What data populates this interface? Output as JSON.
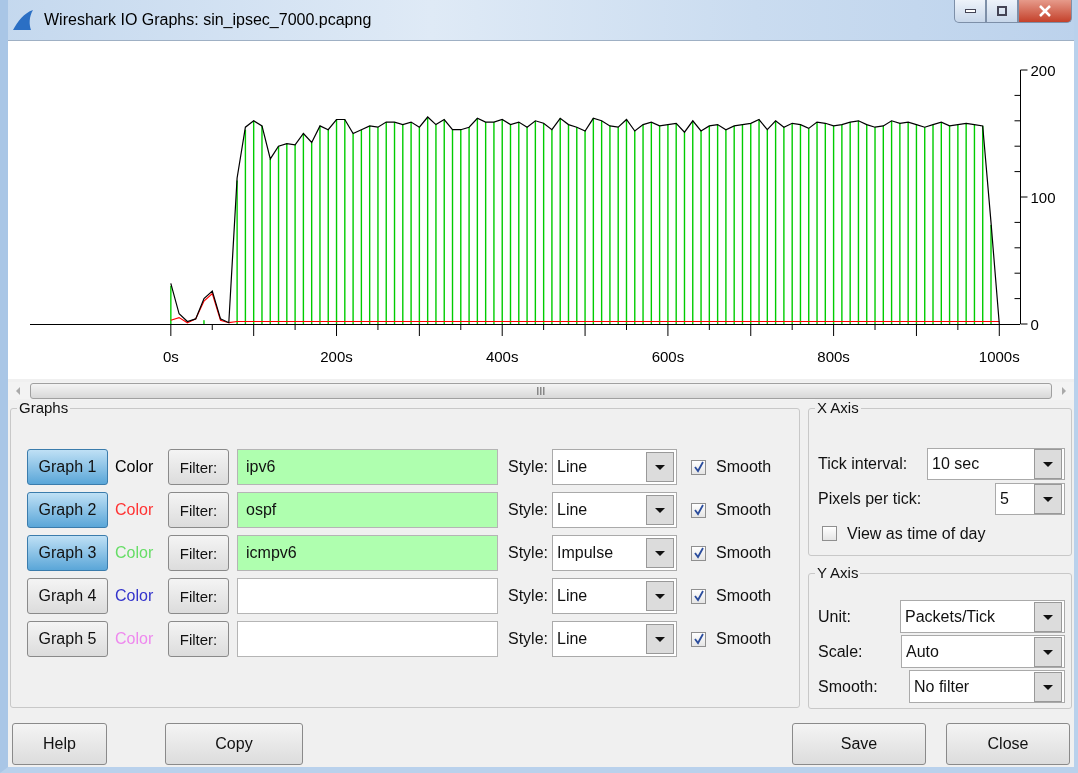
{
  "window": {
    "title": "Wireshark IO Graphs: sin_ipsec_7000.pcapng"
  },
  "chart": {
    "chart_data": {
      "type": "line",
      "xlim": [
        -170,
        1025
      ],
      "ylim": [
        0,
        200
      ],
      "xticks": [
        {
          "value": 0,
          "label": "0s"
        },
        {
          "value": 200,
          "label": "200s"
        },
        {
          "value": 400,
          "label": "400s"
        },
        {
          "value": 600,
          "label": "600s"
        },
        {
          "value": 800,
          "label": "800s"
        },
        {
          "value": 1000,
          "label": "1000s"
        }
      ],
      "yticks": [
        0,
        100,
        200
      ],
      "x": [
        0,
        10,
        20,
        30,
        40,
        50,
        60,
        70,
        80,
        90,
        100,
        110,
        120,
        130,
        140,
        150,
        160,
        170,
        180,
        190,
        200,
        210,
        220,
        230,
        240,
        250,
        260,
        270,
        280,
        290,
        300,
        310,
        320,
        330,
        340,
        350,
        360,
        370,
        380,
        390,
        400,
        410,
        420,
        430,
        440,
        450,
        460,
        470,
        480,
        490,
        500,
        510,
        520,
        530,
        540,
        550,
        560,
        570,
        580,
        590,
        600,
        610,
        620,
        630,
        640,
        650,
        660,
        670,
        680,
        690,
        700,
        710,
        720,
        730,
        740,
        750,
        760,
        770,
        780,
        790,
        800,
        810,
        820,
        830,
        840,
        850,
        860,
        870,
        880,
        890,
        900,
        910,
        920,
        930,
        940,
        950,
        960,
        970,
        980,
        990,
        1000
      ],
      "series": [
        {
          "color": "#000000",
          "values": [
            32,
            8,
            2,
            4,
            20,
            26,
            4,
            1,
            115,
            155,
            160,
            156,
            130,
            140,
            142,
            141,
            150,
            143,
            156,
            153,
            161,
            161,
            150,
            153,
            156,
            155,
            159,
            159,
            157,
            159,
            155,
            163,
            157,
            161,
            153,
            153,
            155,
            162,
            159,
            159,
            161,
            157,
            159,
            155,
            160,
            158,
            153,
            162,
            157,
            155,
            152,
            162,
            160,
            156,
            155,
            161,
            152,
            157,
            159,
            156,
            157,
            158,
            151,
            160,
            152,
            156,
            157,
            153,
            156,
            157,
            158,
            161,
            153,
            160,
            155,
            158,
            157,
            154,
            159,
            158,
            156,
            157,
            159,
            160,
            157,
            155,
            156,
            160,
            158,
            159,
            157,
            155,
            157,
            159,
            156,
            157,
            158,
            157,
            156,
            80,
            0
          ]
        },
        {
          "color": "#ff0000",
          "values": [
            3,
            5,
            1,
            4,
            18,
            24,
            3,
            1,
            2,
            2,
            2,
            2,
            2,
            2,
            2,
            2,
            2,
            2,
            2,
            2,
            2,
            2,
            2,
            2,
            2,
            2,
            2,
            2,
            2,
            2,
            2,
            2,
            2,
            2,
            2,
            2,
            2,
            2,
            2,
            2,
            2,
            2,
            2,
            2,
            2,
            2,
            2,
            2,
            2,
            2,
            2,
            2,
            2,
            2,
            2,
            2,
            2,
            2,
            2,
            2,
            2,
            2,
            2,
            2,
            2,
            2,
            2,
            2,
            2,
            2,
            2,
            2,
            2,
            2,
            2,
            2,
            2,
            2,
            2,
            2,
            2,
            2,
            2,
            2,
            2,
            2,
            2,
            2,
            2,
            2,
            2,
            2,
            2,
            2,
            2,
            2,
            2,
            2,
            2,
            2,
            2
          ]
        },
        {
          "type": "bar",
          "color": "#00cc00",
          "values": [
            30,
            null,
            null,
            null,
            3,
            null,
            null,
            null,
            113,
            153,
            160,
            156,
            130,
            140,
            142,
            141,
            150,
            143,
            156,
            153,
            161,
            161,
            150,
            153,
            156,
            155,
            159,
            159,
            157,
            159,
            155,
            163,
            157,
            161,
            153,
            153,
            155,
            162,
            159,
            159,
            161,
            157,
            159,
            155,
            160,
            158,
            153,
            162,
            157,
            155,
            152,
            162,
            160,
            156,
            155,
            161,
            152,
            157,
            159,
            156,
            157,
            158,
            151,
            160,
            152,
            156,
            157,
            153,
            156,
            157,
            158,
            161,
            153,
            160,
            155,
            158,
            157,
            154,
            159,
            158,
            156,
            157,
            159,
            160,
            157,
            155,
            156,
            160,
            158,
            159,
            157,
            155,
            157,
            159,
            156,
            157,
            158,
            157,
            156,
            78,
            null
          ]
        }
      ]
    }
  },
  "graphs_group": {
    "title": "Graphs",
    "graphs": [
      {
        "label": "Graph 1",
        "selected": true,
        "color": "#000000",
        "color_label": "Color",
        "filter_button": "Filter:",
        "filter": "ipv6",
        "style_label": "Style:",
        "style": "Line",
        "smooth": true,
        "smooth_label": "Smooth"
      },
      {
        "label": "Graph 2",
        "selected": true,
        "color": "#ff3333",
        "color_label": "Color",
        "filter_button": "Filter:",
        "filter": "ospf",
        "style_label": "Style:",
        "style": "Line",
        "smooth": true,
        "smooth_label": "Smooth"
      },
      {
        "label": "Graph 3",
        "selected": true,
        "color": "#66dd66",
        "color_label": "Color",
        "filter_button": "Filter:",
        "filter": "icmpv6",
        "style_label": "Style:",
        "style": "Impulse",
        "smooth": true,
        "smooth_label": "Smooth"
      },
      {
        "label": "Graph 4",
        "selected": false,
        "color": "#3333cc",
        "color_label": "Color",
        "filter_button": "Filter:",
        "style_label": "Style:",
        "style": "Line",
        "smooth": true,
        "smooth_label": "Smooth"
      },
      {
        "label": "Graph 5",
        "selected": false,
        "color": "#ee88ee",
        "color_label": "Color",
        "filter_button": "Filter:",
        "style_label": "Style:",
        "style": "Line",
        "smooth": true,
        "smooth_label": "Smooth"
      }
    ]
  },
  "x_axis": {
    "title": "X Axis",
    "tick_interval_label": "Tick interval:",
    "tick_interval": "10 sec",
    "pixels_per_tick_label": "Pixels per tick:",
    "pixels_per_tick": "5",
    "time_of_day_label": "View as time of day",
    "time_of_day": false
  },
  "y_axis": {
    "title": "Y Axis",
    "unit_label": "Unit:",
    "unit": "Packets/Tick",
    "scale_label": "Scale:",
    "scale": "Auto",
    "smooth_label": "Smooth:",
    "smooth": "No filter"
  },
  "buttons_left": [
    "Help",
    "Copy"
  ],
  "buttons_right": [
    "Save",
    "Close"
  ]
}
